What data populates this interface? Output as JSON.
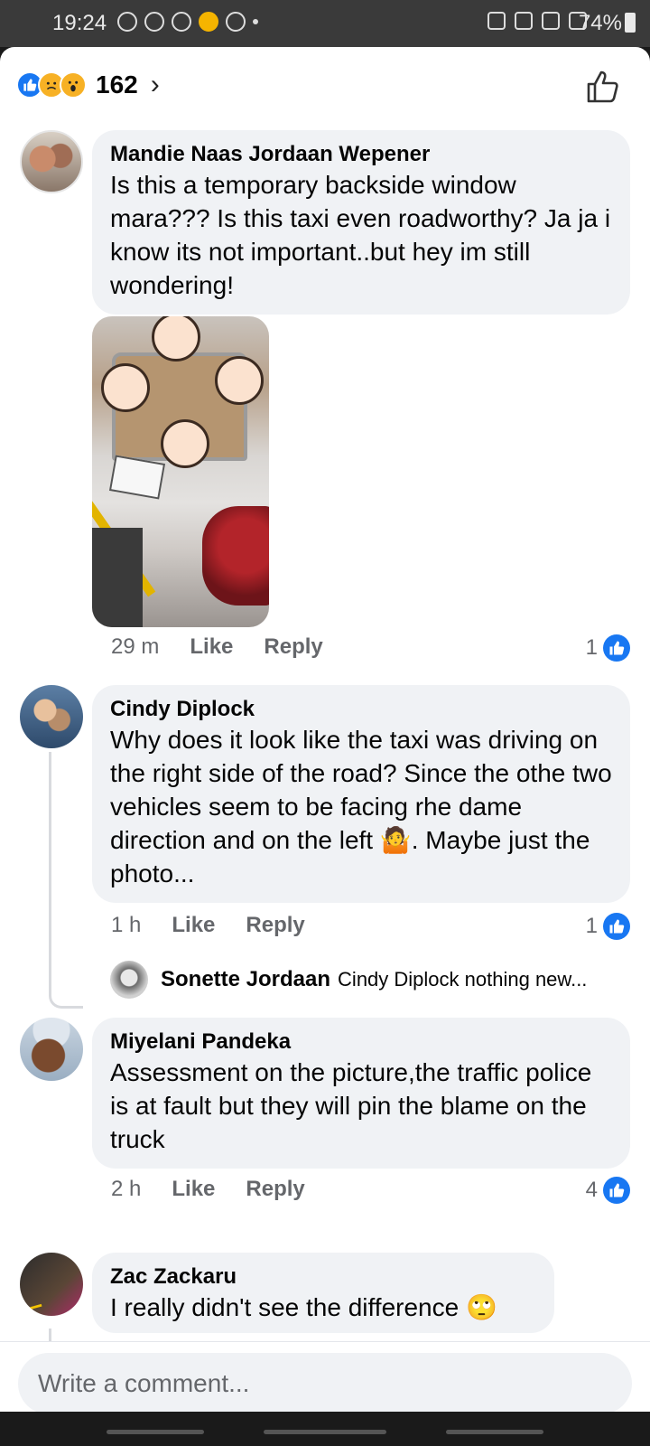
{
  "status_bar": {
    "time": "19:24",
    "battery": "74%"
  },
  "reactions": {
    "count": "162",
    "icons": [
      "like-icon",
      "sad-icon",
      "wow-icon"
    ]
  },
  "comments": [
    {
      "author": "Mandie Naas Jordaan Wepener",
      "text": "Is this a temporary backside window mara??? Is this taxi even roadworthy? Ja ja i know its not important..but hey im still wondering!",
      "time": "29 m",
      "like_label": "Like",
      "reply_label": "Reply",
      "likes": "1"
    },
    {
      "author": "Cindy Diplock",
      "text": "Why does it look like the taxi was driving on the right side of the road? Since the othe two vehicles seem to be facing rhe dame direction and on the left 🤷. Maybe just the photo...",
      "time": "1 h",
      "like_label": "Like",
      "reply_label": "Reply",
      "likes": "1",
      "reply_preview": {
        "author": "Sonette Jordaan",
        "text": "Cindy Diplock nothing new..."
      }
    },
    {
      "author": "Miyelani Pandeka",
      "text": "Assessment on the picture,the traffic police is at fault but they will pin the blame on the truck",
      "time": "2 h",
      "like_label": "Like",
      "reply_label": "Reply",
      "likes": "4"
    },
    {
      "author": "Zac Zackaru",
      "text": "I really didn't see the difference 🙄"
    }
  ],
  "composer": {
    "placeholder": "Write a comment..."
  },
  "colors": {
    "brand_blue": "#1877f2",
    "bubble_bg": "#f0f2f5",
    "meta_gray": "#65676b"
  }
}
